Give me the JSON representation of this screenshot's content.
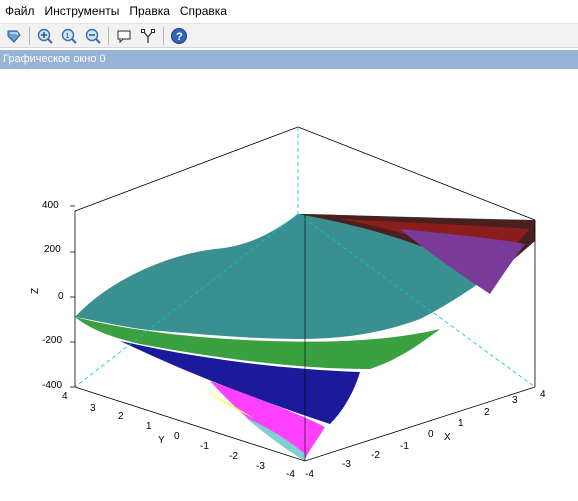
{
  "menu": {
    "items": [
      "Файл",
      "Инструменты",
      "Правка",
      "Справка"
    ]
  },
  "toolbar": {
    "buttons": [
      "rotate-icon",
      "zoom-in-icon",
      "zoom-fit-icon",
      "zoom-out-icon",
      "datatip-icon",
      "datatip-edit-icon",
      "help-icon"
    ]
  },
  "window": {
    "title": "Графическое окно 0"
  },
  "chart_data": {
    "type": "surface",
    "title": "",
    "xlabel": "X",
    "ylabel": "Y",
    "zlabel": "Z",
    "xlim": [
      -4,
      4
    ],
    "ylim": [
      -4,
      4
    ],
    "zlim": [
      -400,
      400
    ],
    "z_ticks": [
      "400",
      "200",
      "0",
      "-200",
      "-400"
    ],
    "x_ticks": [
      "-4",
      "-3",
      "-2",
      "-1",
      "0",
      "1",
      "2",
      "3",
      "4"
    ],
    "y_ticks": [
      "4",
      "3",
      "2",
      "1",
      "0",
      "-1",
      "-2",
      "-3",
      "-4"
    ],
    "grid": false,
    "colors": [
      "#4a1f1f",
      "#8b1d1d",
      "#7a3a9a",
      "#c040c0",
      "#3a9090",
      "#3aa040",
      "#7fd0d0",
      "#1a1a9a",
      "#ffff40",
      "#ff40ff"
    ]
  }
}
